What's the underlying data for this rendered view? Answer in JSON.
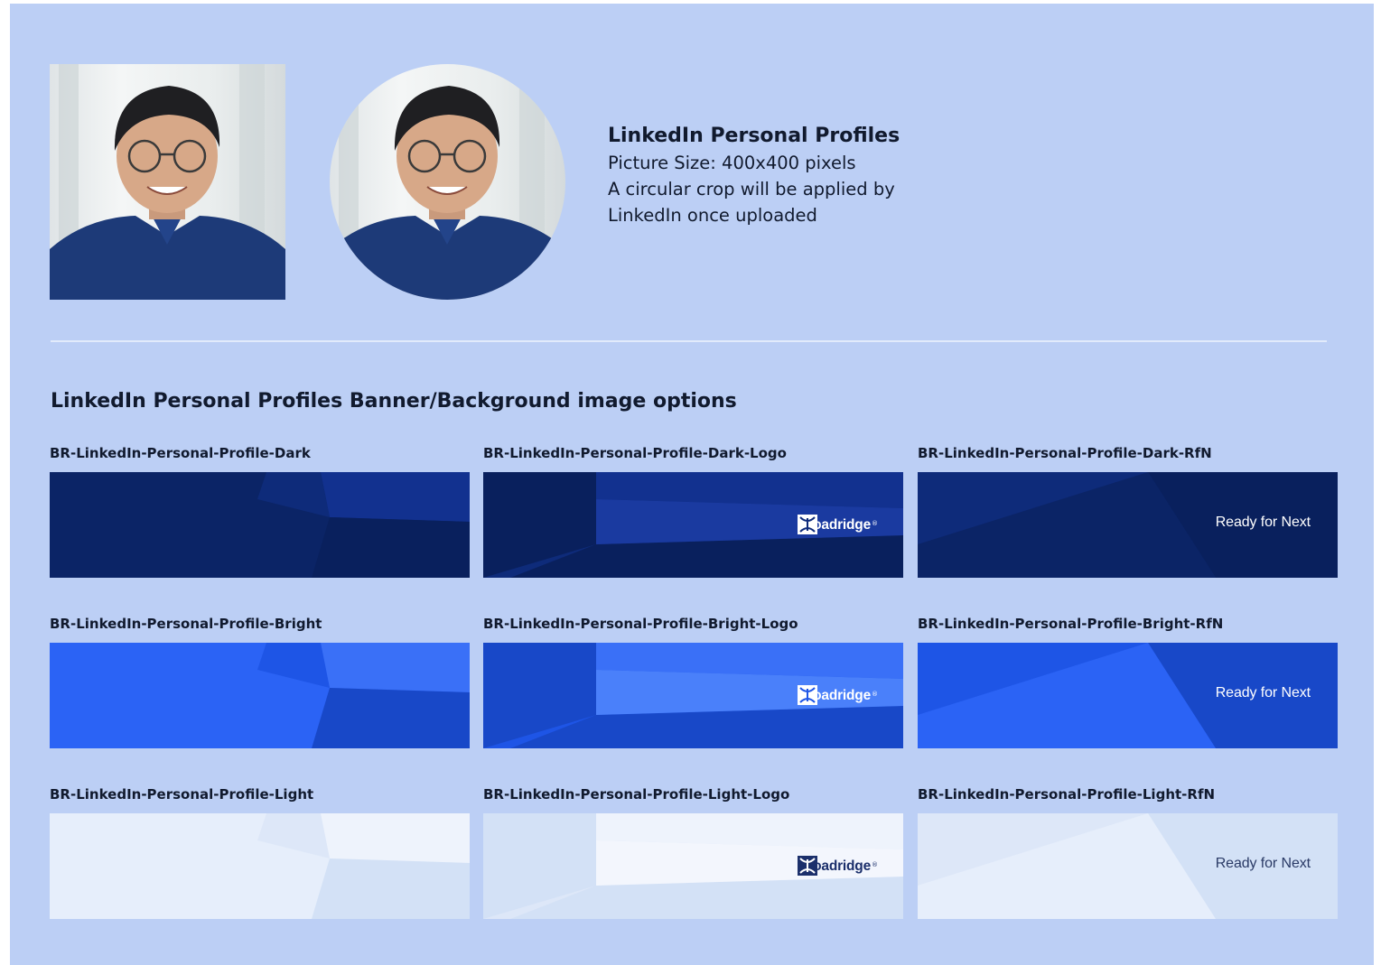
{
  "profile": {
    "title": "LinkedIn Personal Profiles",
    "lines": [
      "Picture Size: 400x400 pixels",
      "A circular crop will be applied by",
      "LinkedIn once uploaded"
    ]
  },
  "banner_section": {
    "heading": "LinkedIn Personal Profiles Banner/Background image options"
  },
  "banner_text": {
    "logo": "Broadridge",
    "logo_mark": "®",
    "rfn": "Ready for Next"
  },
  "banners": [
    {
      "label": "BR-LinkedIn-Personal-Profile-Dark",
      "theme": "dark",
      "overlay": "none"
    },
    {
      "label": "BR-LinkedIn-Personal-Profile-Dark-Logo",
      "theme": "dark",
      "overlay": "logo"
    },
    {
      "label": "BR-LinkedIn-Personal-Profile-Dark-RfN",
      "theme": "dark",
      "overlay": "rfn"
    },
    {
      "label": "BR-LinkedIn-Personal-Profile-Bright",
      "theme": "bright",
      "overlay": "none"
    },
    {
      "label": "BR-LinkedIn-Personal-Profile-Bright-Logo",
      "theme": "bright",
      "overlay": "logo"
    },
    {
      "label": "BR-LinkedIn-Personal-Profile-Bright-RfN",
      "theme": "bright",
      "overlay": "rfn"
    },
    {
      "label": "BR-LinkedIn-Personal-Profile-Light",
      "theme": "light",
      "overlay": "none"
    },
    {
      "label": "BR-LinkedIn-Personal-Profile-Light-Logo",
      "theme": "light",
      "overlay": "logo"
    },
    {
      "label": "BR-LinkedIn-Personal-Profile-Light-RfN",
      "theme": "light",
      "overlay": "rfn"
    }
  ],
  "colors": {
    "background": "#bccff5",
    "text": "#111a2e",
    "divider": "#e2ebfb",
    "dark": [
      "#0b2466",
      "#0e2b7a",
      "#12318f",
      "#09205d",
      "#1a3aa0"
    ],
    "bright": [
      "#2b63f5",
      "#1e55e6",
      "#3a70f7",
      "#1848c8",
      "#4a80fa"
    ],
    "light": [
      "#e6eefb",
      "#dde7f8",
      "#eef3fc",
      "#d3e1f6",
      "#f3f6fd"
    ],
    "logo_light": "#ffffff",
    "logo_dark": "#1b2f6b"
  }
}
